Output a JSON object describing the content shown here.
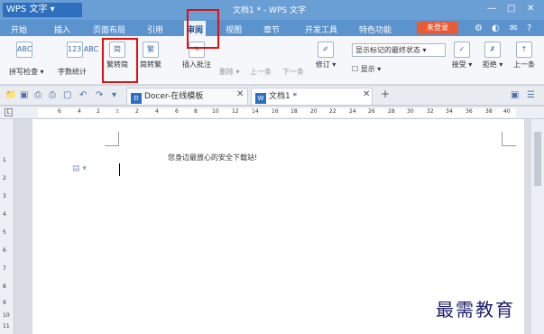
{
  "app": {
    "name": "WPS 文字",
    "doc_title": "文档1 * - WPS 文字"
  },
  "menu": [
    "开始",
    "插入",
    "页面布局",
    "引用",
    "审阅",
    "视图",
    "章节",
    "开发工具",
    "特色功能"
  ],
  "active_menu": "审阅",
  "login_label": "未登录",
  "ribbon": {
    "abc_label": "ABC",
    "abc2_label": "123\nABC",
    "spell_check": "拼写检查",
    "word_count": "字数统计",
    "trad_simp": "繁转简",
    "simp_trad": "简转繁",
    "insert_comment": "插入批注",
    "delete": "删除",
    "prev": "上一条",
    "next": "下一条",
    "revise": "修订",
    "show_markup_select": "显示标记的最终状态",
    "show": "显示",
    "accept": "接受",
    "reject": "拒绝",
    "prev2": "上一条"
  },
  "tabs": {
    "docer": "Docer-在线模板",
    "doc1": "文档1 *"
  },
  "ruler_ticks": [
    "6",
    "4",
    "2",
    "",
    "2",
    "4",
    "6",
    "8",
    "10",
    "12",
    "14",
    "16",
    "18",
    "20",
    "22",
    "24",
    "26",
    "28",
    "30",
    "32",
    "34",
    "36",
    "38",
    "40"
  ],
  "vruler_ticks": [
    "1",
    "2",
    "3",
    "4",
    "5",
    "6",
    "7",
    "8",
    "9",
    "10",
    "11",
    "12"
  ],
  "page_text": "您身边最放心的安全下载站!",
  "watermark": "最需教育",
  "accent_colors": {
    "title": "#6a9fd6",
    "menu": "#5b93cf",
    "login": "#e85b33",
    "highlight": "#e01010"
  }
}
